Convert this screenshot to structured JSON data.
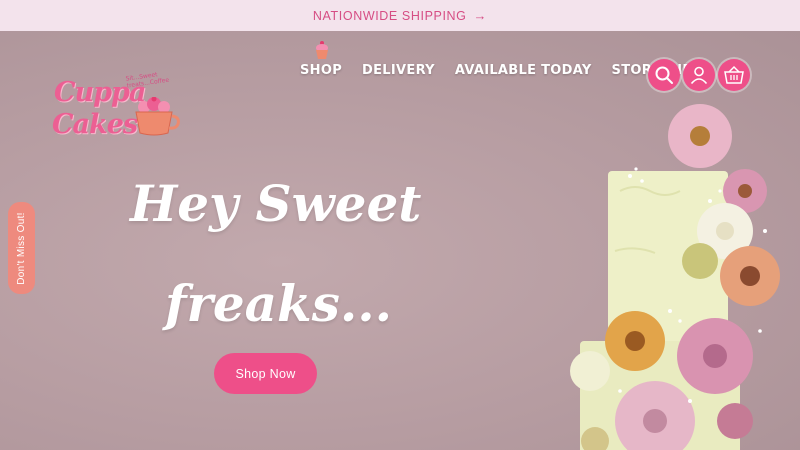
{
  "announcement": {
    "text": "NATIONWIDE SHIPPING",
    "arrow": "→"
  },
  "logo": {
    "line1": "Cuppa",
    "line2": "Cakes",
    "tagline": "Sit...Sweet treats...Coffee"
  },
  "nav": {
    "items": [
      {
        "label": "SHOP"
      },
      {
        "label": "DELIVERY"
      },
      {
        "label": "AVAILABLE TODAY"
      },
      {
        "label": "STORE INFO"
      }
    ]
  },
  "icons": {
    "search": "search-icon",
    "account": "user-icon",
    "cart": "basket-icon"
  },
  "side_tab": {
    "label": "Don't Miss Out!"
  },
  "hero": {
    "headline_line1": "Hey Sweet",
    "headline_line2": "freaks...",
    "cta_label": "Shop Now"
  },
  "colors": {
    "brand_pink": "#ee4f89",
    "announcement_bg": "#f3e3ec",
    "side_tab": "#ee8a7e",
    "hero_bg": "#b89ea2"
  }
}
